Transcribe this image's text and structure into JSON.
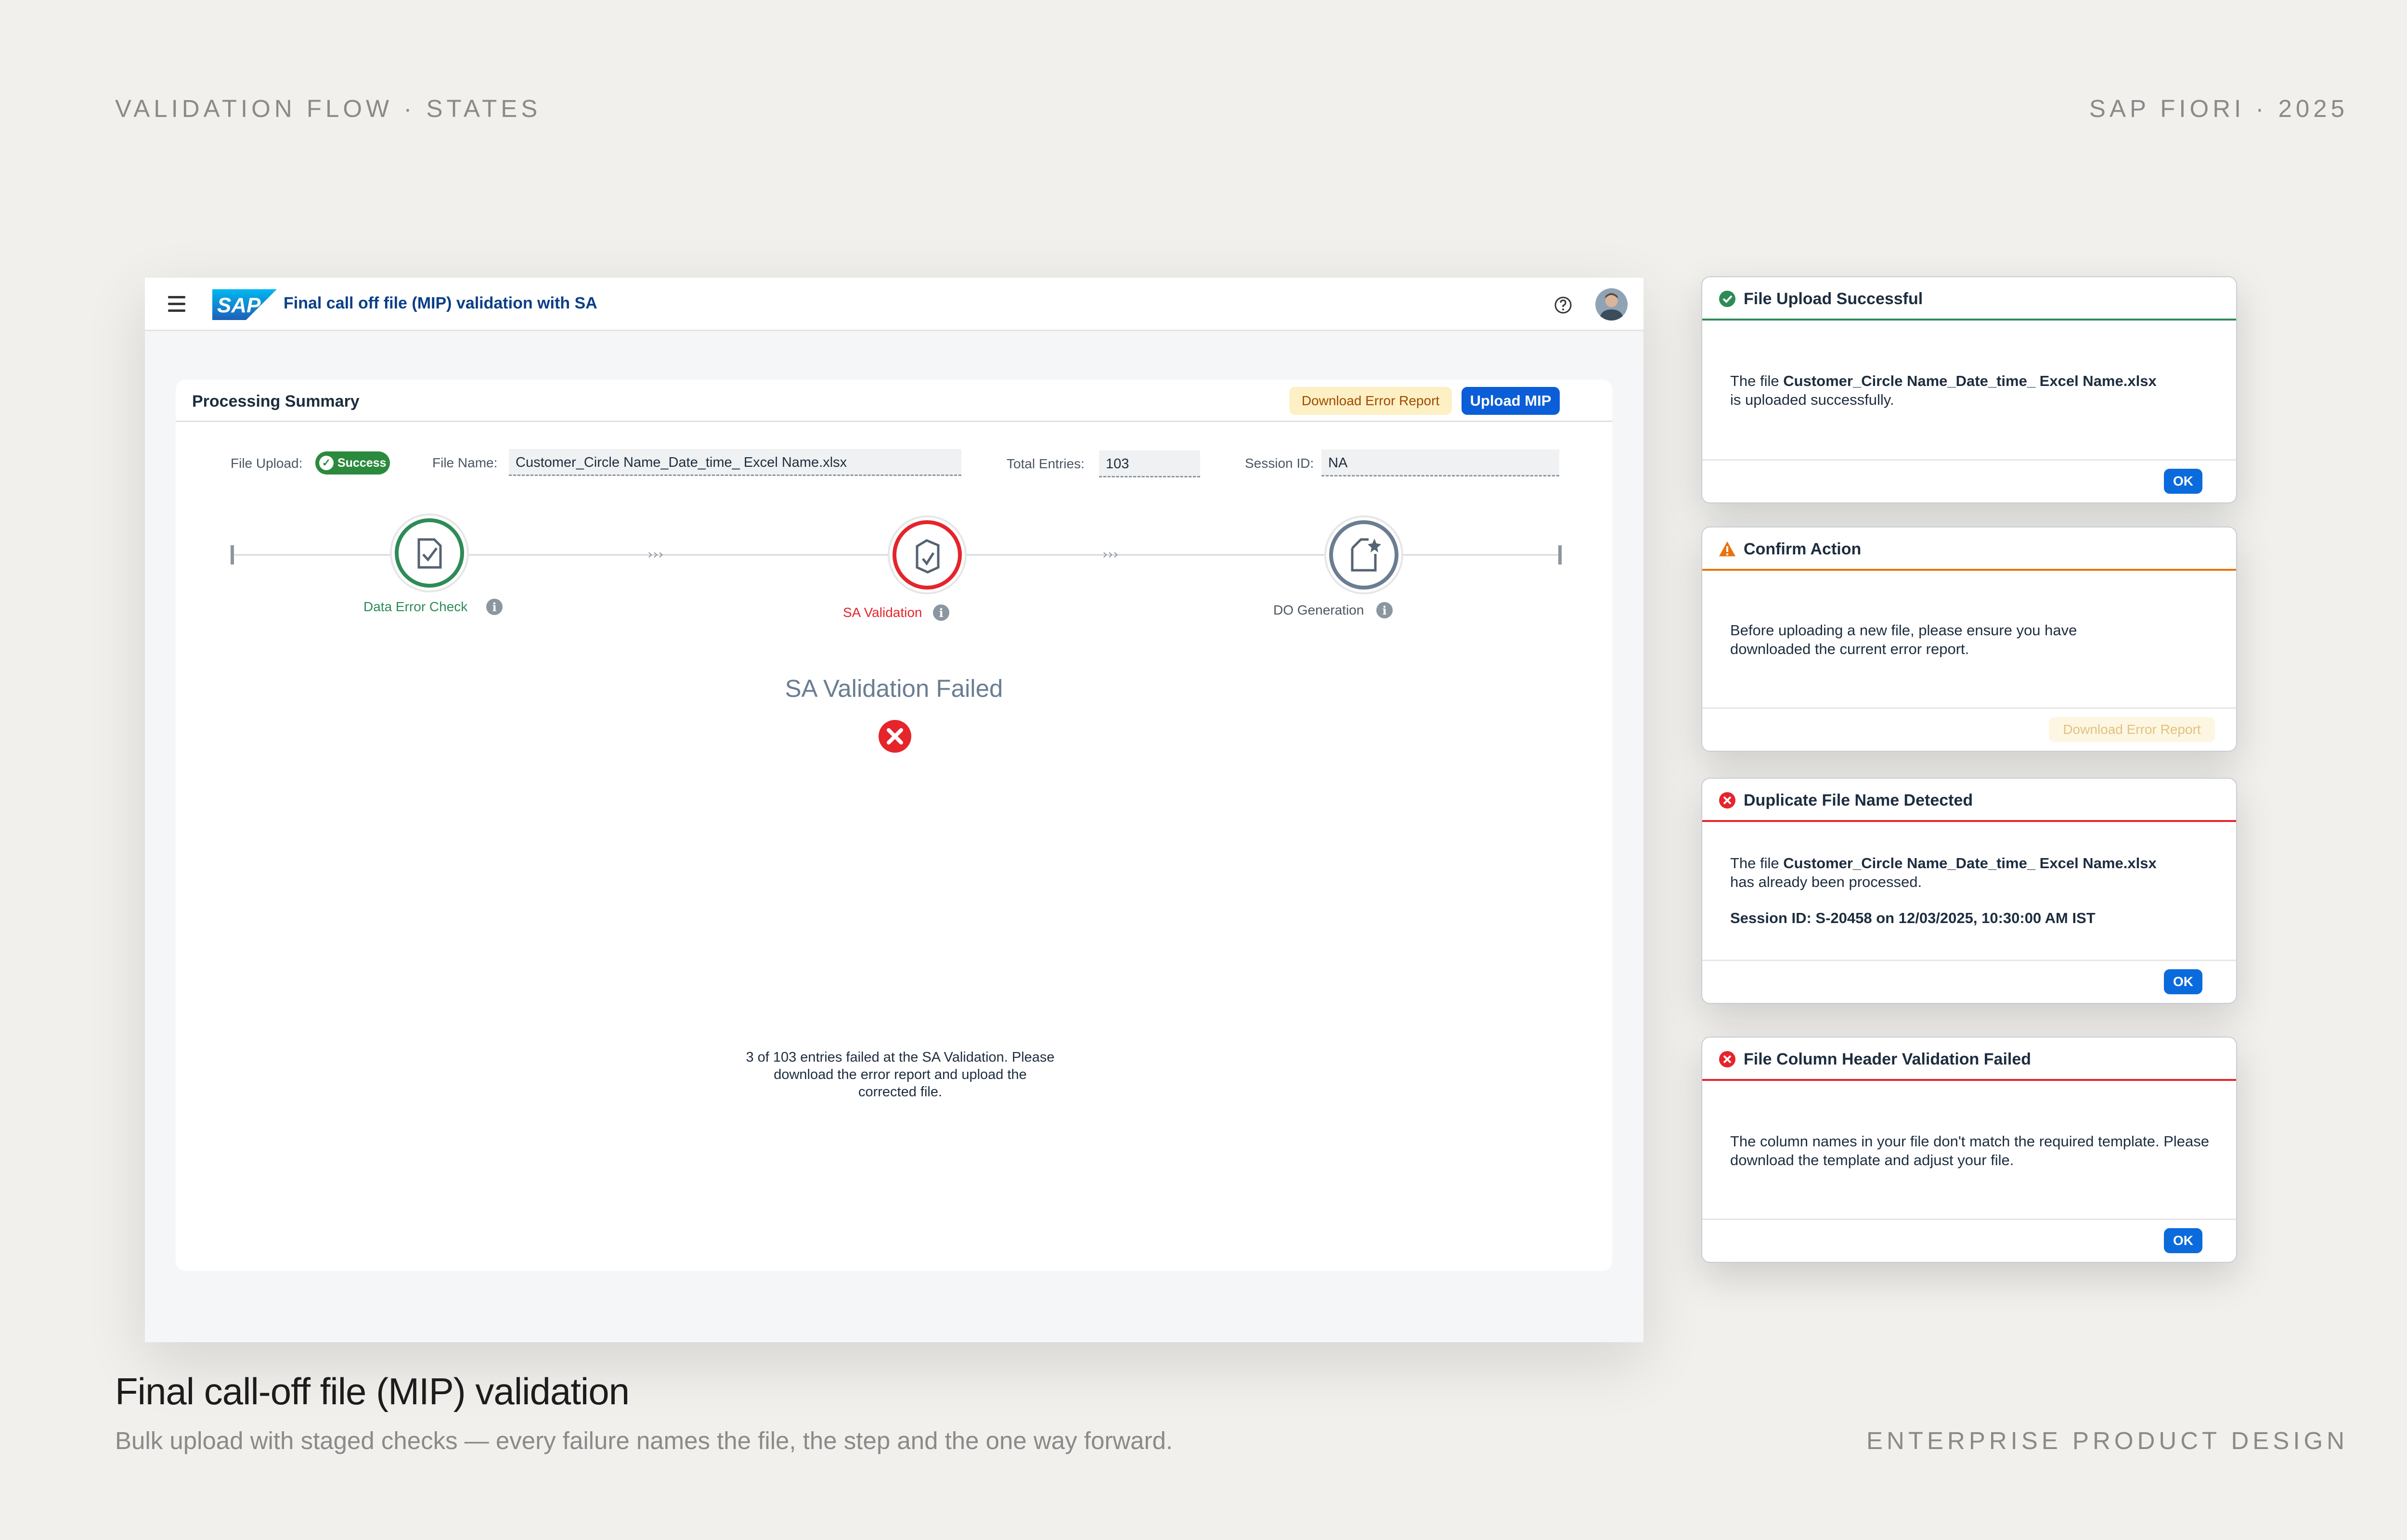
{
  "presentation": {
    "top_left": "VALIDATION FLOW · STATES",
    "top_right": "SAP FIORI · 2025",
    "title": "Final call-off file (MIP) validation",
    "subtitle": "Bulk upload with staged checks — every failure names the file, the step and the one way forward.",
    "footer_right": "ENTERPRISE PRODUCT DESIGN"
  },
  "shell": {
    "logo_text": "SAP",
    "title": "Final call off file (MIP) validation with SA",
    "icons": [
      "menu-icon",
      "help-icon",
      "user-avatar"
    ]
  },
  "summary": {
    "title": "Processing Summary",
    "download_error_report": "Download Error Report",
    "upload_mip": "Upload MIP",
    "file_upload_label": "File Upload:",
    "file_upload_status": "Success",
    "file_name_label": "File Name:",
    "file_name_value": "Customer_Circle Name_Date_time_ Excel Name.xlsx",
    "total_entries_label": "Total Entries:",
    "total_entries_value": "103",
    "session_id_label": "Session ID:",
    "session_id_value": "NA"
  },
  "steps": [
    {
      "label": "Data Error Check",
      "status": "success",
      "color": "#2e8b57"
    },
    {
      "label": "SA Validation",
      "status": "error",
      "color": "#e5242b"
    },
    {
      "label": "DO Generation",
      "status": "pending",
      "color": "#6a7d92"
    }
  ],
  "result": {
    "title": "SA Validation Failed",
    "message": "3 of 103 entries failed at the SA Validation. Please download the error report and upload the corrected file."
  },
  "dialogs": {
    "upload_success": {
      "title": "File Upload Successful",
      "prefix": "The file ",
      "file": "Customer_Circle Name_Date_time_ Excel Name.xlsx",
      "suffix": "is uploaded successfully.",
      "ok": "OK"
    },
    "confirm": {
      "title": "Confirm Action",
      "body": "Before uploading a new file, please ensure you have downloaded the current error report.",
      "button": "Download Error Report"
    },
    "duplicate": {
      "title": "Duplicate File Name Detected",
      "prefix": "The file ",
      "file": "Customer_Circle Name_Date_time_ Excel Name.xlsx",
      "suffix": "has already been processed.",
      "session": "Session ID: S-20458 on 12/03/2025, 10:30:00 AM IST",
      "ok": "OK"
    },
    "header_failed": {
      "title": "File Column Header Validation Failed",
      "body": "The column names in your file don't match the required template. Please download the template and adjust your file.",
      "ok": "OK"
    }
  },
  "colors": {
    "success": "#2e8b57",
    "warning": "#e9730c",
    "error": "#e5242b",
    "brand": "#0b6bdc"
  }
}
